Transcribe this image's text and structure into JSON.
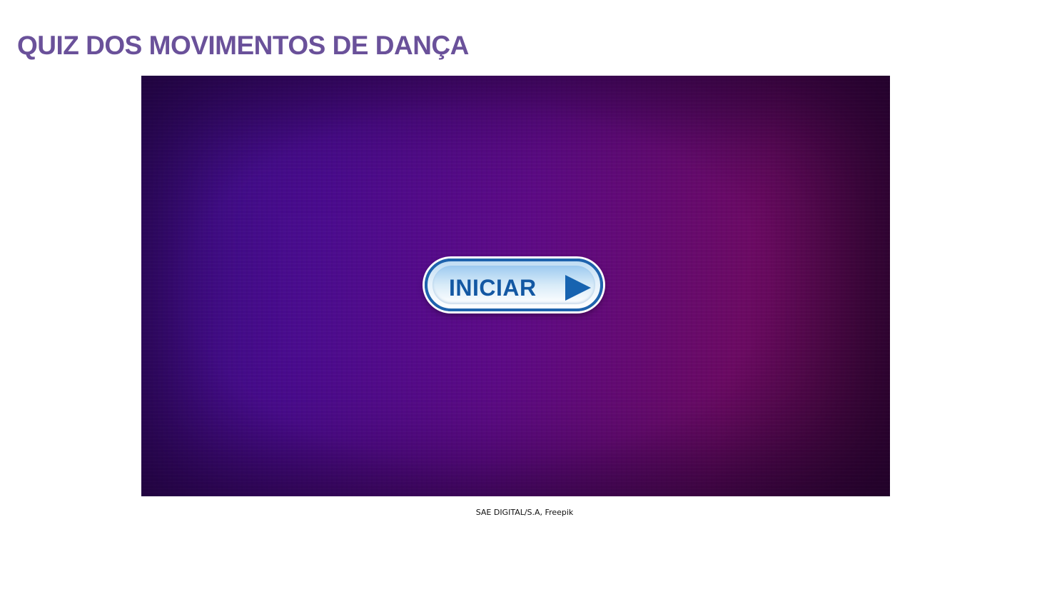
{
  "page": {
    "title": "QUIZ DOS MOVIMENTOS DE DANÇA",
    "credit": "SAE DIGITAL/S.A, Freepik"
  },
  "quiz": {
    "start_label": "INICIAR",
    "start_icon": "play-icon"
  },
  "colors": {
    "title": "#6a519a",
    "button_border": "#1e63ad",
    "button_text": "#1358a3",
    "background_left": "#3a0e86",
    "background_right": "#6b0a63"
  }
}
